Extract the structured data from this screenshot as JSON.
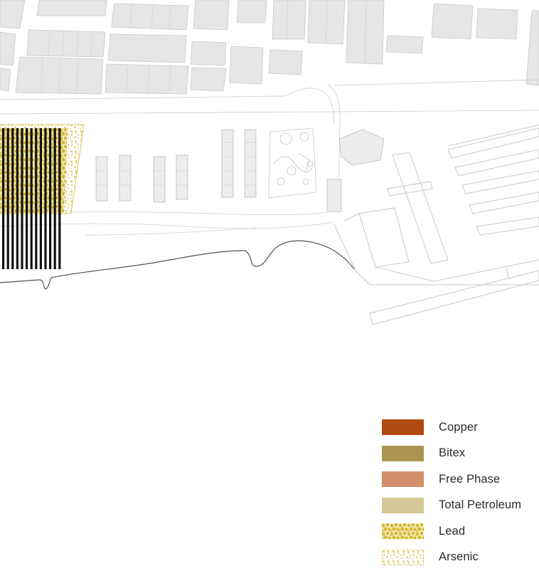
{
  "legend": {
    "items": [
      {
        "label": "Copper",
        "color": "#b04a10",
        "pattern": "solid"
      },
      {
        "label": "Bitex",
        "color": "#ad9550",
        "pattern": "solid"
      },
      {
        "label": "Free Phase",
        "color": "#d1906b",
        "pattern": "solid"
      },
      {
        "label": "Total Petroleum",
        "color": "#d6c899",
        "pattern": "solid"
      },
      {
        "label": "Lead",
        "color": "#d6b730",
        "pattern": "dense-speckle"
      },
      {
        "label": "Arsenic",
        "color": "#d6b730",
        "pattern": "sparse-speckle"
      }
    ]
  },
  "colors": {
    "block_fill": "#e6e6e6",
    "block_stroke": "#c9c9c9",
    "line_gray": "#cfcfcf",
    "shoreline": "#555555",
    "stripes": "#111111"
  }
}
